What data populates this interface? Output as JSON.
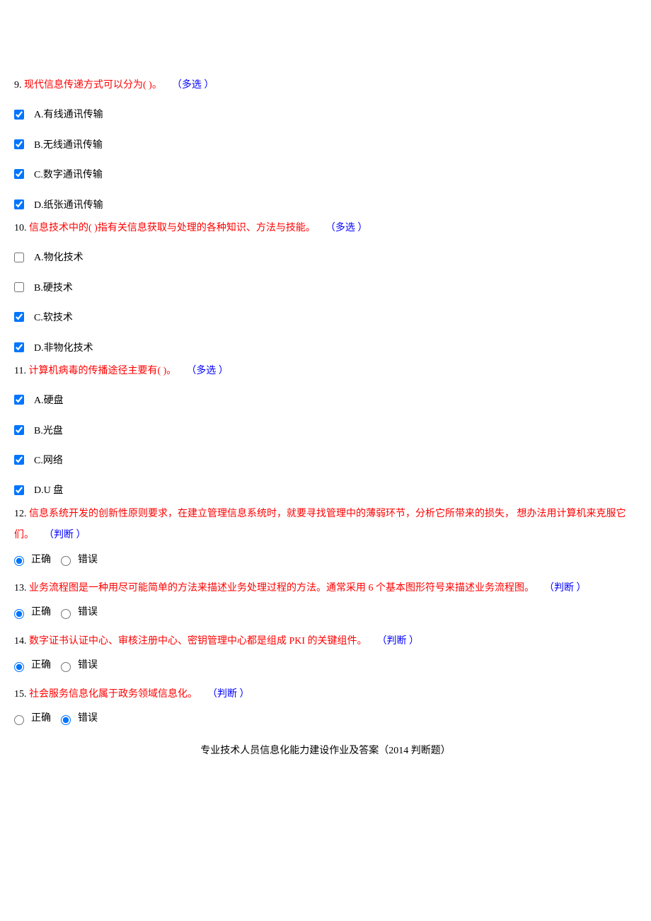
{
  "questions": [
    {
      "num": "9.",
      "text": "现代信息传递方式可以分为( )。",
      "tag": "（多选 ）",
      "type": "multi",
      "options": [
        {
          "label": "A.有线通讯传输",
          "checked": true
        },
        {
          "label": "B.无线通讯传输",
          "checked": true
        },
        {
          "label": "C.数字通讯传输",
          "checked": true
        },
        {
          "label": "D.纸张通讯传输",
          "checked": true
        }
      ]
    },
    {
      "num": "10.",
      "text": "信息技术中的( )指有关信息获取与处理的各种知识、方法与技能。",
      "tag": "（多选 ）",
      "type": "multi",
      "options": [
        {
          "label": "A.物化技术",
          "checked": false
        },
        {
          "label": "B.硬技术",
          "checked": false
        },
        {
          "label": "C.软技术",
          "checked": true
        },
        {
          "label": "D.非物化技术",
          "checked": true
        }
      ]
    },
    {
      "num": "11.",
      "text": "计算机病毒的传播途径主要有( )。",
      "tag": "（多选 ）",
      "type": "multi",
      "options": [
        {
          "label": "A.硬盘",
          "checked": true
        },
        {
          "label": "B.光盘",
          "checked": true
        },
        {
          "label": "C.网络",
          "checked": true
        },
        {
          "label": "D.U 盘",
          "checked": true
        }
      ]
    },
    {
      "num": "12.",
      "text": "信息系统开发的创新性原则要求，在建立管理信息系统时，就要寻找管理中的薄弱环节，分析它所带来的损失， 想办法用计算机来克服它",
      "text2": "们。",
      "tag": "（判断 ）",
      "type": "tf",
      "true_label": "正确",
      "false_label": "错误",
      "selected": "true"
    },
    {
      "num": "13.",
      "text": "业务流程图是一种用尽可能简单的方法来描述业务处理过程的方法。通常采用 6 个基本图形符号来描述业务流程图。",
      "tag": "（判断 ）",
      "type": "tf",
      "true_label": "正确",
      "false_label": "错误",
      "selected": "true"
    },
    {
      "num": "14.",
      "text": "数字证书认证中心、审核注册中心、密钥管理中心都是组成 PKI 的关键组件。",
      "tag": "（判断 ）",
      "type": "tf",
      "true_label": "正确",
      "false_label": "错误",
      "selected": "true"
    },
    {
      "num": "15.",
      "text": "社会服务信息化属于政务领域信息化。",
      "tag": "（判断 ）",
      "type": "tf",
      "true_label": "正确",
      "false_label": "错误",
      "selected": "false"
    }
  ],
  "footer_title": "专业技术人员信息化能力建设作业及答案（2014 判断题）"
}
